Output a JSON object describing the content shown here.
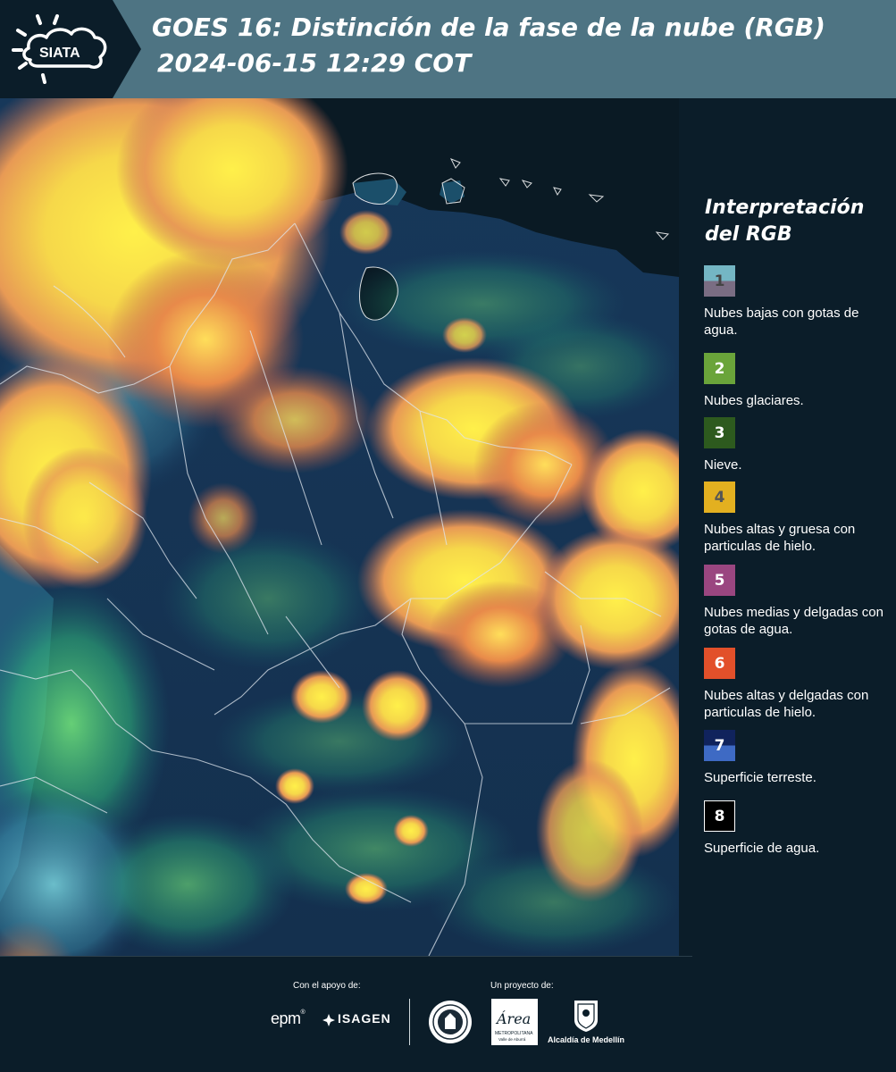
{
  "header": {
    "logo_text": "SIATA",
    "title": "GOES 16: Distinción de la fase de la nube (RGB)",
    "timestamp": "2024-06-15 12:29 COT"
  },
  "legend": {
    "title_line1": "Interpretación",
    "title_line2": "del RGB",
    "items": [
      {
        "number": "1",
        "label": "Nubes bajas con gotas de agua.",
        "colors": [
          "#74b6c4",
          "#7a6d83"
        ],
        "num_color": "#444444"
      },
      {
        "number": "2",
        "label": "Nubes glaciares.",
        "colors": [
          "#6aa43a"
        ],
        "num_color": "#ffffff"
      },
      {
        "number": "3",
        "label": "Nieve.",
        "colors": [
          "#2d5a1e"
        ],
        "num_color": "#ffffff"
      },
      {
        "number": "4",
        "label": "Nubes altas y gruesa con particulas de hielo.",
        "colors": [
          "#e3b020"
        ],
        "num_color": "#555555"
      },
      {
        "number": "5",
        "label": "Nubes medias y delgadas con gotas de agua.",
        "colors": [
          "#9a4680"
        ],
        "num_color": "#ffffff"
      },
      {
        "number": "6",
        "label": "Nubes altas y delgadas con particulas de hielo.",
        "colors": [
          "#e2502a"
        ],
        "num_color": "#ffffff"
      },
      {
        "number": "7",
        "label": "Superficie terreste.",
        "colors": [
          "#10235c",
          "#3e6ac4"
        ],
        "num_color": "#ffffff"
      },
      {
        "number": "8",
        "label": "Superficie de agua.",
        "colors": [
          "#000000"
        ],
        "num_color": "#ffffff"
      }
    ]
  },
  "footer": {
    "support_label": "Con el apoyo de:",
    "project_label": "Un proyecto de:",
    "sponsor_epm": "epm",
    "sponsor_isagen": "ISAGEN",
    "area_logo_text": "Área",
    "area_logo_sub1": "METROPOLITANA",
    "area_logo_sub2": "Valle de Aburrá",
    "alcaldia": "Alcaldía de Medellín"
  }
}
